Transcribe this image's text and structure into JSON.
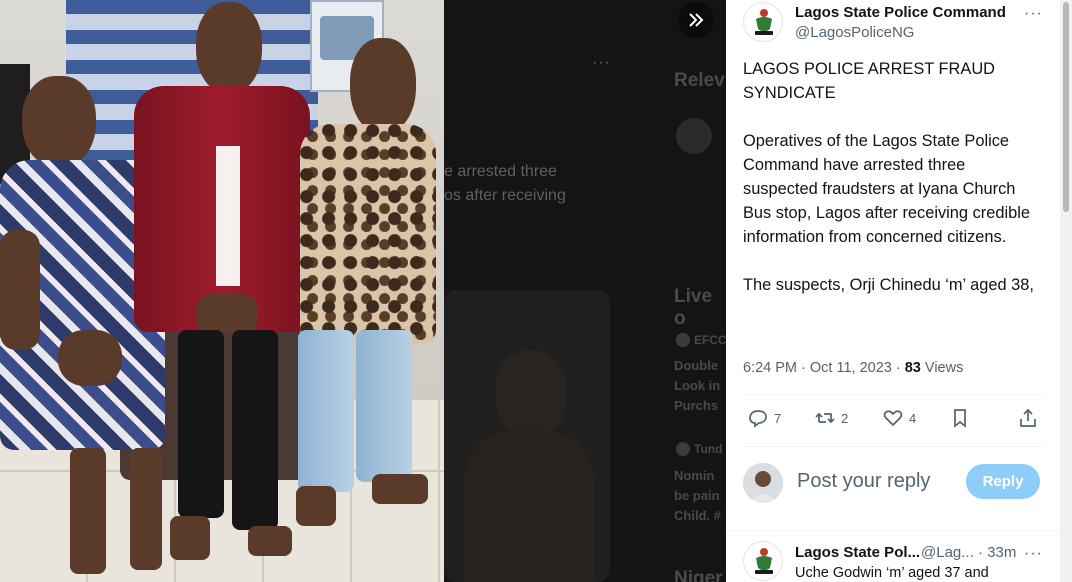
{
  "backdrop": {
    "trailing_text_1": "e arrested three",
    "trailing_text_2": "os after receiving",
    "sidebar_heading_1": "Relev",
    "sidebar_heading_2": "Live o",
    "trend_1_source": "EFCC",
    "trend_1_lines": [
      "Double",
      "Look in",
      "Purchs"
    ],
    "trend_2_source": "Tund",
    "trend_2_lines": [
      "Nomin",
      "be pain",
      "Child. #"
    ],
    "sidebar_heading_3": "Niger"
  },
  "photo": {
    "alt_icon": "arrested-suspects-photo"
  },
  "tweet": {
    "display_name": "Lagos State Police Command",
    "handle": "@LagosPoliceNG",
    "text": "LAGOS POLICE ARREST FRAUD SYNDICATE\n\nOperatives of the Lagos State Police Command have arrested three suspected fraudsters at Iyana Church Bus stop, Lagos after receiving credible information from concerned citizens.\n\nThe suspects, Orji Chinedu ‘m’ aged 38,",
    "time": "6:24 PM · Oct 11, 2023 · ",
    "views_count": "83",
    "views_label": " Views",
    "actions": {
      "replies": "7",
      "retweets": "2",
      "likes": "4"
    }
  },
  "reply_box": {
    "placeholder": "Post your reply",
    "button": "Reply"
  },
  "next_reply": {
    "display_name": "Lagos State Pol...",
    "handle": "@Lag...",
    "time": "· 33m",
    "text": "Uche Godwin ‘m’ aged 37 and"
  },
  "colors": {
    "accent": "#1d9bf0",
    "reply_button": "#8ecdf8",
    "text_primary": "#0f1419",
    "text_secondary": "#536471"
  }
}
